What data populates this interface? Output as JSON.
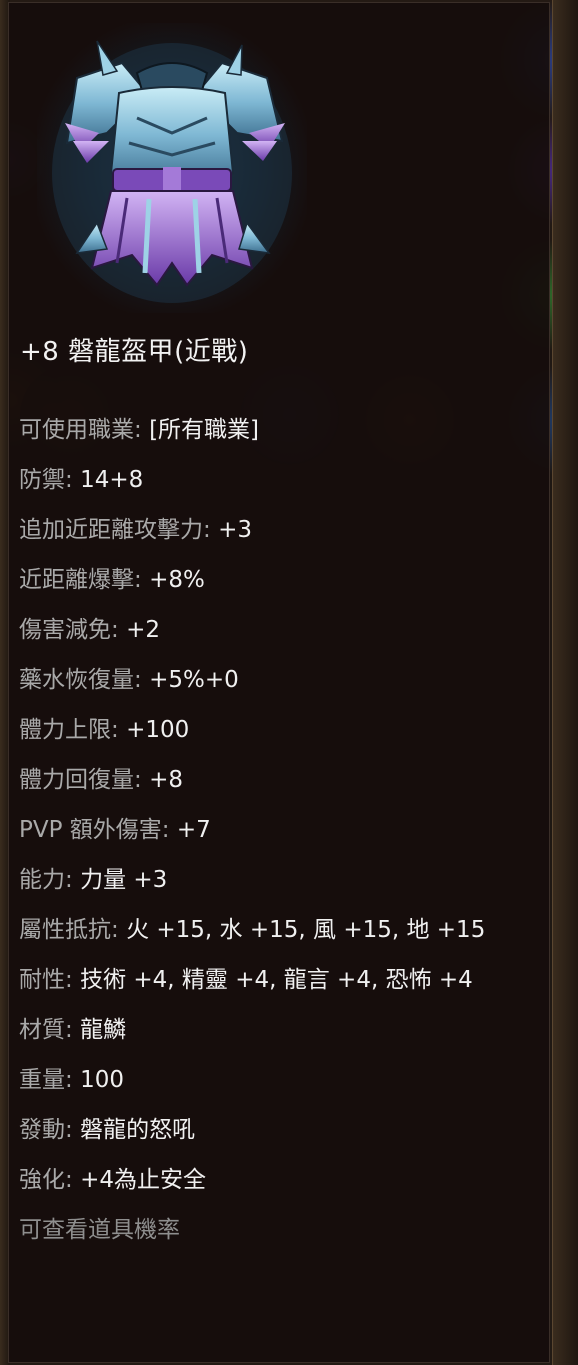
{
  "item": {
    "name": "+8 磐龍盔甲(近戰)",
    "image_icon": "dragon-armor-icon"
  },
  "stats": [
    {
      "label": "可使用職業:",
      "value": "[所有職業]"
    },
    {
      "label": "防禦:",
      "value": "14+8"
    },
    {
      "label": "追加近距離攻擊力:",
      "value": "+3"
    },
    {
      "label": "近距離爆擊:",
      "value": "+8%"
    },
    {
      "label": "傷害減免:",
      "value": "+2"
    },
    {
      "label": "藥水恢復量:",
      "value": "+5%+0"
    },
    {
      "label": "體力上限:",
      "value": "+100"
    },
    {
      "label": "體力回復量:",
      "value": "+8"
    },
    {
      "label": "PVP 額外傷害:",
      "value": "+7"
    },
    {
      "label": "能力:",
      "value": "力量 +3"
    },
    {
      "label": "屬性抵抗:",
      "value": "火 +15, 水 +15, 風 +15, 地 +15"
    },
    {
      "label": "耐性:",
      "value": "技術 +4, 精靈 +4, 龍言 +4, 恐怖 +4"
    },
    {
      "label": "材質:",
      "value": "龍鱗"
    },
    {
      "label": "重量:",
      "value": "100"
    },
    {
      "label": "發動:",
      "value": "磐龍的怒吼"
    },
    {
      "label": "強化:",
      "value": "+4為止安全"
    }
  ],
  "footer_text": "可查看道具機率",
  "colors": {
    "tooltip_bg": "#160d0c",
    "label": "#a9a9a9",
    "value": "#f0f0f0",
    "armor_main": "#7fb8d4",
    "armor_accent": "#9a66d8"
  }
}
